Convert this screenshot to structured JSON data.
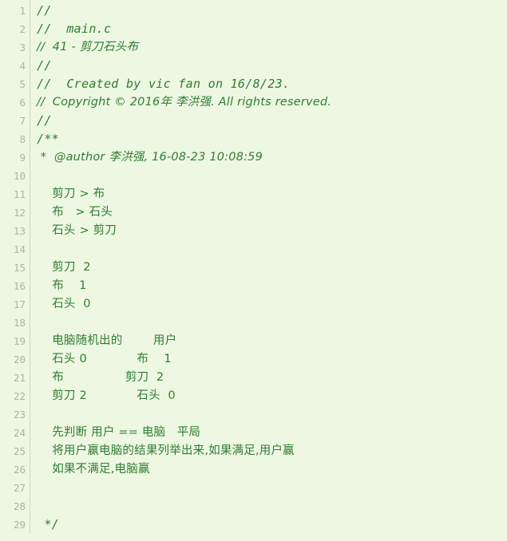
{
  "editor": {
    "language": "c",
    "filename": "main.c",
    "colors": {
      "background": "#eef7e2",
      "comment_text": "#2e7d32",
      "gutter_text": "#a8b99a",
      "gutter_border": "#c9dcb4"
    },
    "first_visible_line": 1,
    "last_visible_line": 29,
    "total_visible_lines": 29
  },
  "gutter": {
    "numbers": [
      "1",
      "2",
      "3",
      "4",
      "5",
      "6",
      "7",
      "8",
      "9",
      "10",
      "11",
      "12",
      "13",
      "14",
      "15",
      "16",
      "17",
      "18",
      "19",
      "20",
      "21",
      "22",
      "23",
      "24",
      "25",
      "26",
      "27",
      "28",
      "29"
    ]
  },
  "code": {
    "lines": [
      {
        "n": 1,
        "text": "//",
        "style": "italic"
      },
      {
        "n": 2,
        "text": "//  main.c",
        "style": "italic"
      },
      {
        "n": 3,
        "text": "//  41 - 剪刀石头布",
        "style": "italic-cjk"
      },
      {
        "n": 4,
        "text": "//",
        "style": "italic"
      },
      {
        "n": 5,
        "text": "//  Created by vic fan on 16/8/23.",
        "style": "italic"
      },
      {
        "n": 6,
        "text": "//  Copyright © 2016年 李洪强. All rights reserved.",
        "style": "italic-cjk"
      },
      {
        "n": 7,
        "text": "//",
        "style": "italic"
      },
      {
        "n": 8,
        "text": "/**",
        "style": "italic"
      },
      {
        "n": 9,
        "text": " *  @author 李洪强, 16-08-23 10:08:59",
        "style": "italic-cjk"
      },
      {
        "n": 10,
        "text": "",
        "style": "plain"
      },
      {
        "n": 11,
        "text": "    剪刀 > 布",
        "style": "cjk"
      },
      {
        "n": 12,
        "text": "    布   > 石头",
        "style": "cjk"
      },
      {
        "n": 13,
        "text": "    石头 > 剪刀",
        "style": "cjk"
      },
      {
        "n": 14,
        "text": "",
        "style": "plain"
      },
      {
        "n": 15,
        "text": "    剪刀  2",
        "style": "cjk"
      },
      {
        "n": 16,
        "text": "    布    1",
        "style": "cjk"
      },
      {
        "n": 17,
        "text": "    石头  0",
        "style": "cjk"
      },
      {
        "n": 18,
        "text": "",
        "style": "plain"
      },
      {
        "n": 19,
        "text": "    电脑随机出的        用户",
        "style": "cjk"
      },
      {
        "n": 20,
        "text": "    石头 0             布    1",
        "style": "cjk"
      },
      {
        "n": 21,
        "text": "    布                剪刀  2",
        "style": "cjk"
      },
      {
        "n": 22,
        "text": "    剪刀 2             石头  0",
        "style": "cjk"
      },
      {
        "n": 23,
        "text": "",
        "style": "plain"
      },
      {
        "n": 24,
        "text": "    先判断 用户 == 电脑   平局",
        "style": "cjk"
      },
      {
        "n": 25,
        "text": "    将用户赢电脑的结果列举出来,如果满足,用户赢",
        "style": "cjk"
      },
      {
        "n": 26,
        "text": "    如果不满足,电脑赢",
        "style": "cjk"
      },
      {
        "n": 27,
        "text": "",
        "style": "plain"
      },
      {
        "n": 28,
        "text": "",
        "style": "plain"
      },
      {
        "n": 29,
        "text": " */",
        "style": "italic"
      }
    ]
  }
}
